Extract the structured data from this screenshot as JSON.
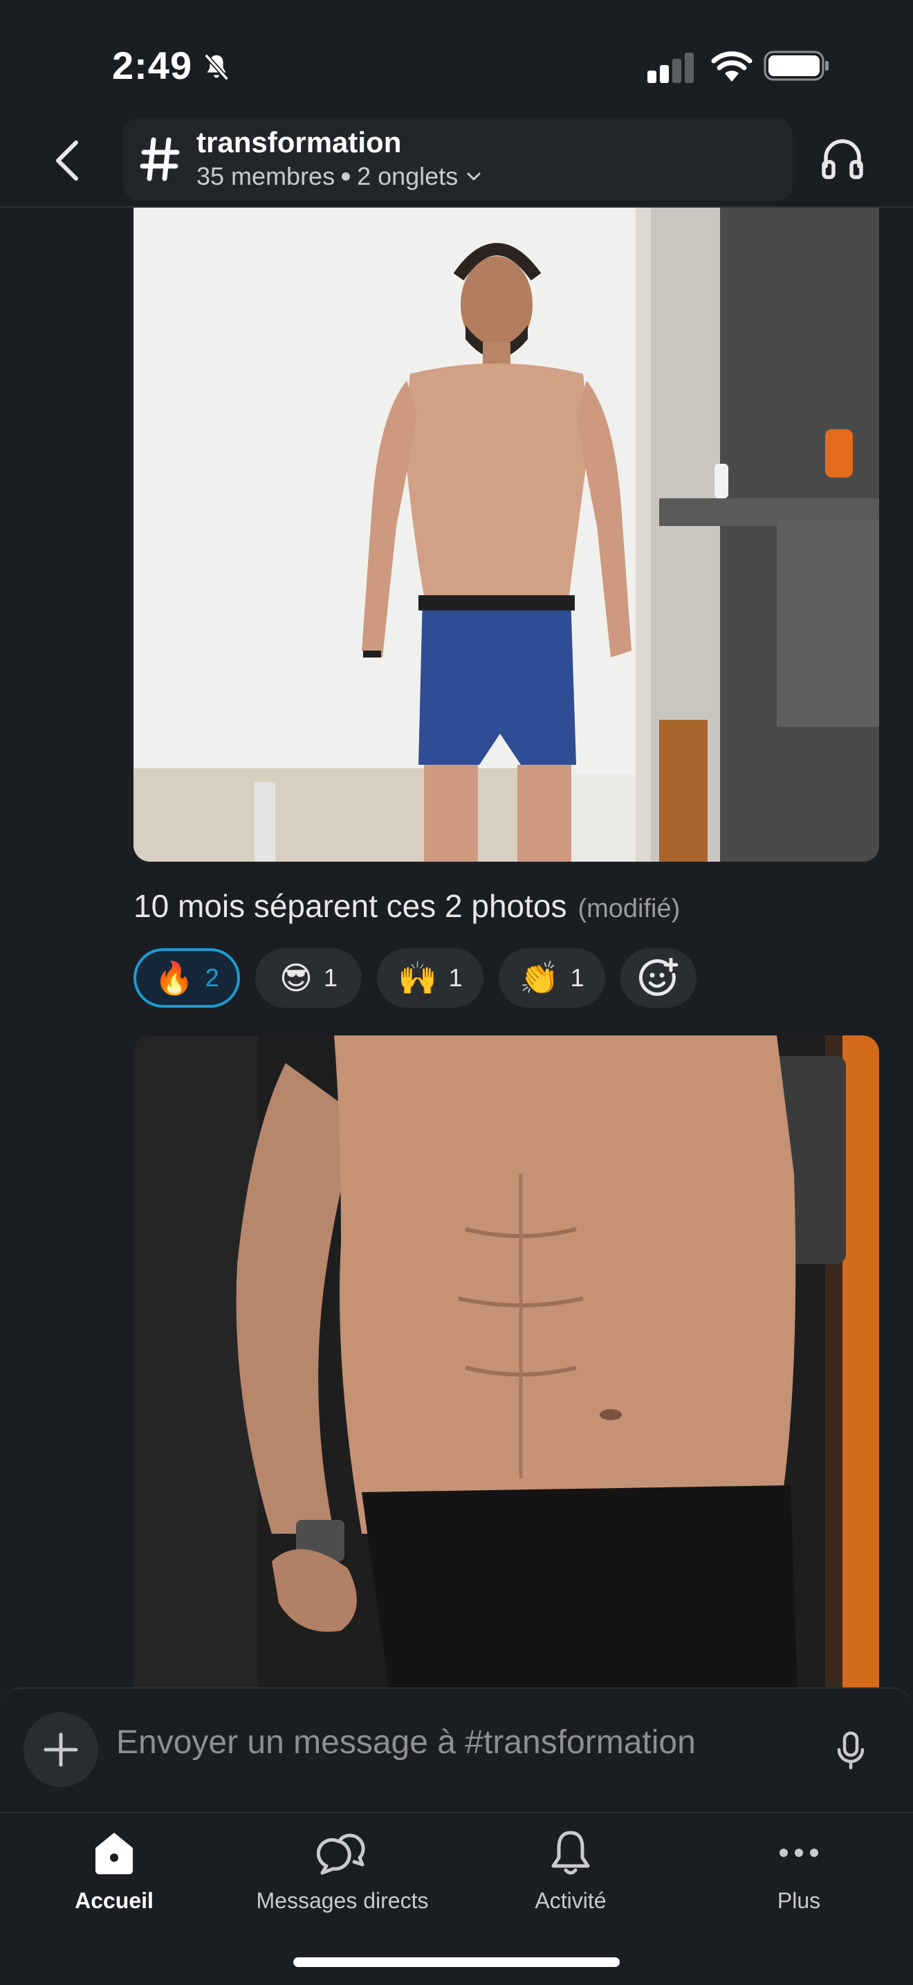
{
  "status_bar": {
    "time": "2:49"
  },
  "header": {
    "channel_name": "transformation",
    "members": "35 membres",
    "tabs": "2 onglets"
  },
  "message": {
    "text": "10 mois séparent ces 2 photos",
    "edited": "(modifié)"
  },
  "reactions": [
    {
      "emoji": "🔥",
      "count": "2",
      "active": true
    },
    {
      "emoji": "😎",
      "count": "1"
    },
    {
      "emoji": "🙌",
      "count": "1"
    },
    {
      "emoji": "👏",
      "count": "1"
    }
  ],
  "composer": {
    "placeholder": "Envoyer un message à #transformation"
  },
  "tabbar": {
    "items": [
      {
        "label": "Accueil",
        "icon": "home-icon",
        "active": true
      },
      {
        "label": "Messages directs",
        "icon": "chat-bubbles-icon"
      },
      {
        "label": "Activité",
        "icon": "bell-icon"
      },
      {
        "label": "Plus",
        "icon": "more-icon"
      }
    ]
  },
  "colors": {
    "accent": "#1d9bd1",
    "background": "#1a1d21"
  }
}
